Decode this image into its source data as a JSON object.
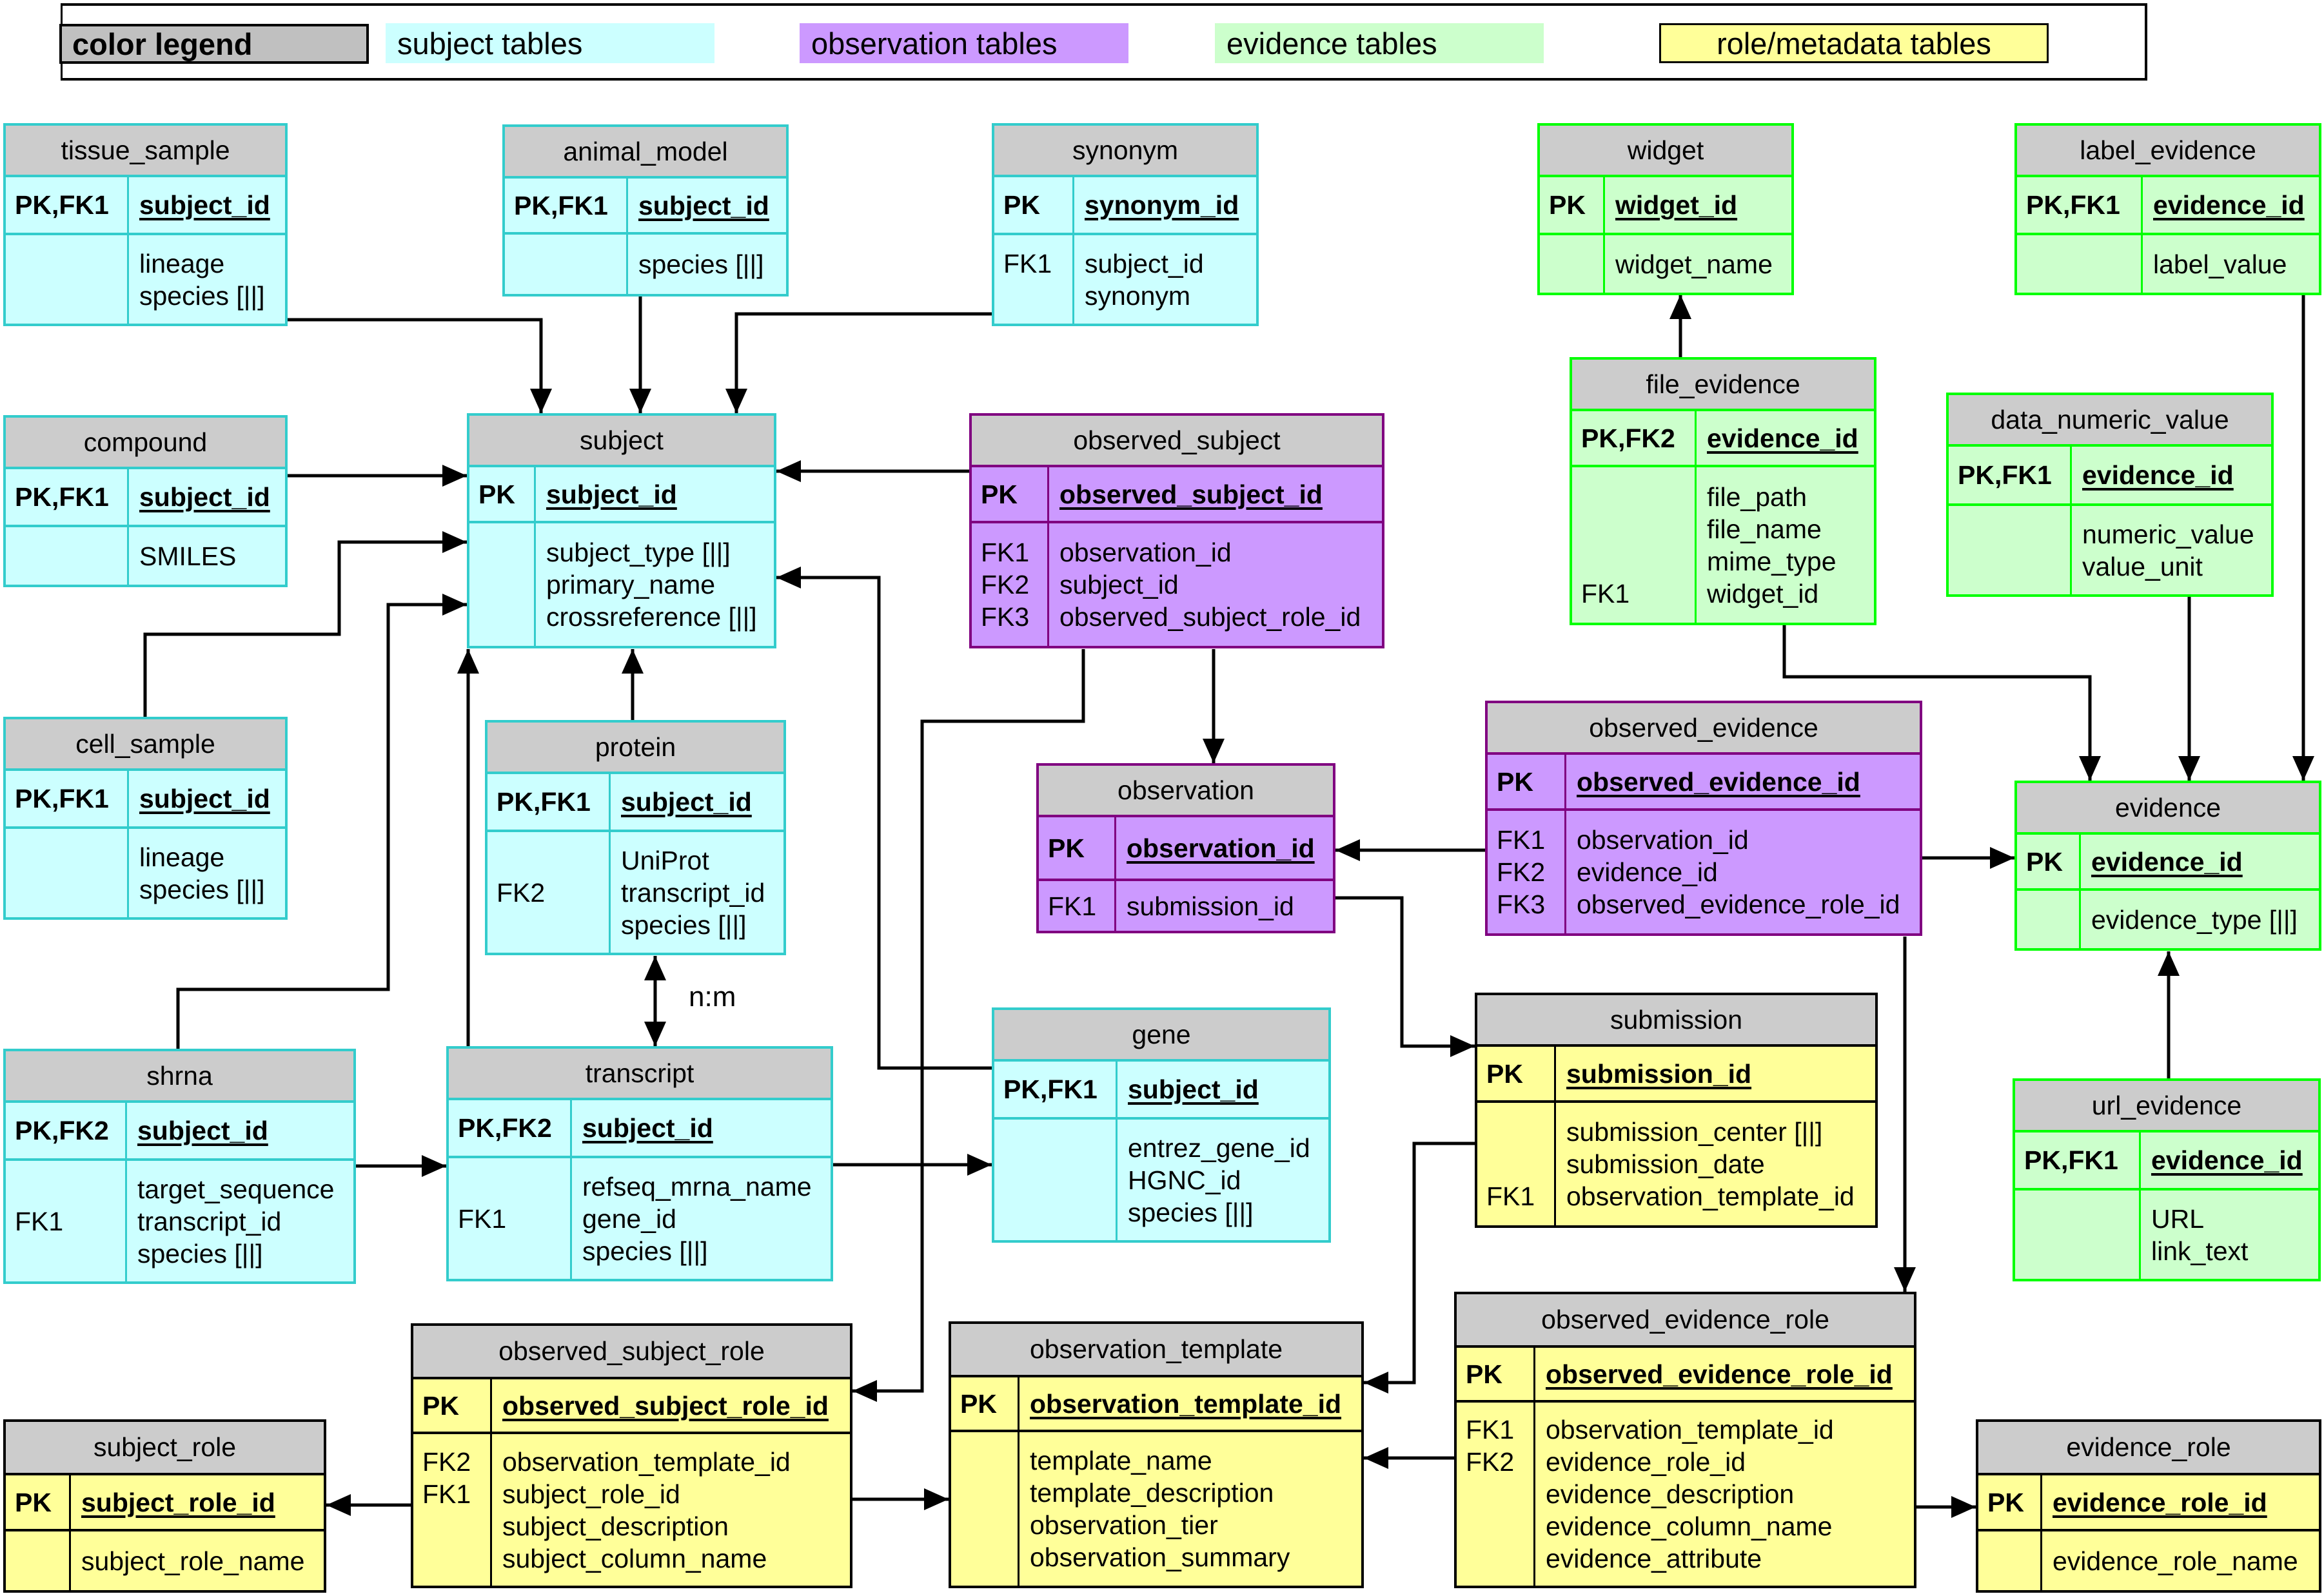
{
  "legend": {
    "title": "color legend",
    "items": [
      {
        "label": "subject tables",
        "color": "#ccffff"
      },
      {
        "label": "observation tables",
        "color": "#cc99ff"
      },
      {
        "label": "evidence tables",
        "color": "#ccffcc"
      },
      {
        "label": "role/metadata tables",
        "color": "#ffff99"
      }
    ]
  },
  "header_color": "#cccccc",
  "relationship_label": "n:m",
  "tables": {
    "tissue_sample": {
      "name": "tissue_sample",
      "category": "subject",
      "pk": {
        "key": "PK,FK1",
        "field": "subject_id"
      },
      "fields": [
        {
          "key": "",
          "field": "lineage"
        },
        {
          "key": "",
          "field": "species [||]"
        }
      ]
    },
    "animal_model": {
      "name": "animal_model",
      "category": "subject",
      "pk": {
        "key": "PK,FK1",
        "field": "subject_id"
      },
      "fields": [
        {
          "key": "",
          "field": "species [||]"
        }
      ]
    },
    "synonym": {
      "name": "synonym",
      "category": "subject",
      "pk": {
        "key": "PK",
        "field": "synonym_id"
      },
      "fields": [
        {
          "key": "FK1",
          "field": "subject_id"
        },
        {
          "key": "",
          "field": "synonym"
        }
      ]
    },
    "widget": {
      "name": "widget",
      "category": "evidence",
      "pk": {
        "key": "PK",
        "field": "widget_id"
      },
      "fields": [
        {
          "key": "",
          "field": "widget_name"
        }
      ]
    },
    "label_evidence": {
      "name": "label_evidence",
      "category": "evidence",
      "pk": {
        "key": "PK,FK1",
        "field": "evidence_id"
      },
      "fields": [
        {
          "key": "",
          "field": "label_value"
        }
      ]
    },
    "compound": {
      "name": "compound",
      "category": "subject",
      "pk": {
        "key": "PK,FK1",
        "field": "subject_id"
      },
      "fields": [
        {
          "key": "",
          "field": "SMILES"
        }
      ]
    },
    "subject": {
      "name": "subject",
      "category": "subject",
      "pk": {
        "key": "PK",
        "field": "subject_id"
      },
      "fields": [
        {
          "key": "",
          "field": "subject_type [||]"
        },
        {
          "key": "",
          "field": "primary_name"
        },
        {
          "key": "",
          "field": "crossreference [||]"
        }
      ]
    },
    "observed_subject": {
      "name": "observed_subject",
      "category": "observation",
      "pk": {
        "key": "PK",
        "field": "observed_subject_id"
      },
      "fields": [
        {
          "key": "FK1",
          "field": "observation_id"
        },
        {
          "key": "FK2",
          "field": "subject_id"
        },
        {
          "key": "FK3",
          "field": "observed_subject_role_id"
        }
      ]
    },
    "file_evidence": {
      "name": "file_evidence",
      "category": "evidence",
      "pk": {
        "key": "PK,FK2",
        "field": "evidence_id"
      },
      "fields": [
        {
          "key": "",
          "field": "file_path"
        },
        {
          "key": "",
          "field": "file_name"
        },
        {
          "key": "",
          "field": "mime_type"
        },
        {
          "key": "FK1",
          "field": "widget_id"
        }
      ]
    },
    "data_numeric_value": {
      "name": "data_numeric_value",
      "category": "evidence",
      "pk": {
        "key": "PK,FK1",
        "field": "evidence_id"
      },
      "fields": [
        {
          "key": "",
          "field": "numeric_value"
        },
        {
          "key": "",
          "field": "value_unit"
        }
      ]
    },
    "cell_sample": {
      "name": "cell_sample",
      "category": "subject",
      "pk": {
        "key": "PK,FK1",
        "field": "subject_id"
      },
      "fields": [
        {
          "key": "",
          "field": "lineage"
        },
        {
          "key": "",
          "field": "species [||]"
        }
      ]
    },
    "protein": {
      "name": "protein",
      "category": "subject",
      "pk": {
        "key": "PK,FK1",
        "field": "subject_id"
      },
      "fields": [
        {
          "key": "",
          "field": "UniProt"
        },
        {
          "key": "FK2",
          "field": "transcript_id"
        },
        {
          "key": "",
          "field": "species [||]"
        }
      ]
    },
    "observation": {
      "name": "observation",
      "category": "observation",
      "pk": {
        "key": "PK",
        "field": "observation_id"
      },
      "fields": [
        {
          "key": "FK1",
          "field": "submission_id"
        }
      ]
    },
    "observed_evidence": {
      "name": "observed_evidence",
      "category": "observation",
      "pk": {
        "key": "PK",
        "field": "observed_evidence_id"
      },
      "fields": [
        {
          "key": "FK1",
          "field": "observation_id"
        },
        {
          "key": "FK2",
          "field": "evidence_id"
        },
        {
          "key": "FK3",
          "field": "observed_evidence_role_id"
        }
      ]
    },
    "evidence": {
      "name": "evidence",
      "category": "evidence",
      "pk": {
        "key": "PK",
        "field": "evidence_id"
      },
      "fields": [
        {
          "key": "",
          "field": "evidence_type [||]"
        }
      ]
    },
    "shrna": {
      "name": "shrna",
      "category": "subject",
      "pk": {
        "key": "PK,FK2",
        "field": "subject_id"
      },
      "fields": [
        {
          "key": "",
          "field": "target_sequence"
        },
        {
          "key": "FK1",
          "field": "transcript_id"
        },
        {
          "key": "",
          "field": "species [||]"
        }
      ]
    },
    "transcript": {
      "name": "transcript",
      "category": "subject",
      "pk": {
        "key": "PK,FK2",
        "field": "subject_id"
      },
      "fields": [
        {
          "key": "",
          "field": "refseq_mrna_name"
        },
        {
          "key": "FK1",
          "field": "gene_id"
        },
        {
          "key": "",
          "field": "species [||]"
        }
      ]
    },
    "gene": {
      "name": "gene",
      "category": "subject",
      "pk": {
        "key": "PK,FK1",
        "field": "subject_id"
      },
      "fields": [
        {
          "key": "",
          "field": "entrez_gene_id"
        },
        {
          "key": "",
          "field": "HGNC_id"
        },
        {
          "key": "",
          "field": "species [||]"
        }
      ]
    },
    "submission": {
      "name": "submission",
      "category": "meta",
      "pk": {
        "key": "PK",
        "field": "submission_id"
      },
      "fields": [
        {
          "key": "",
          "field": "submission_center [||]"
        },
        {
          "key": "",
          "field": "submission_date"
        },
        {
          "key": "FK1",
          "field": "observation_template_id"
        }
      ]
    },
    "url_evidence": {
      "name": "url_evidence",
      "category": "evidence",
      "pk": {
        "key": "PK,FK1",
        "field": "evidence_id"
      },
      "fields": [
        {
          "key": "",
          "field": "URL"
        },
        {
          "key": "",
          "field": "link_text"
        }
      ]
    },
    "observed_subject_role": {
      "name": "observed_subject_role",
      "category": "meta",
      "pk": {
        "key": "PK",
        "field": "observed_subject_role_id"
      },
      "fields": [
        {
          "key": "FK2",
          "field": "observation_template_id"
        },
        {
          "key": "FK1",
          "field": "subject_role_id"
        },
        {
          "key": "",
          "field": "subject_description"
        },
        {
          "key": "",
          "field": "subject_column_name"
        }
      ]
    },
    "observation_template": {
      "name": "observation_template",
      "category": "meta",
      "pk": {
        "key": "PK",
        "field": "observation_template_id"
      },
      "fields": [
        {
          "key": "",
          "field": "template_name"
        },
        {
          "key": "",
          "field": "template_description"
        },
        {
          "key": "",
          "field": "observation_tier"
        },
        {
          "key": "",
          "field": "observation_summary"
        }
      ]
    },
    "observed_evidence_role": {
      "name": "observed_evidence_role",
      "category": "meta",
      "pk": {
        "key": "PK",
        "field": "observed_evidence_role_id"
      },
      "fields": [
        {
          "key": "FK1",
          "field": "observation_template_id"
        },
        {
          "key": "FK2",
          "field": "evidence_role_id"
        },
        {
          "key": "",
          "field": "evidence_description"
        },
        {
          "key": "",
          "field": "evidence_column_name"
        },
        {
          "key": "",
          "field": "evidence_attribute"
        }
      ]
    },
    "subject_role": {
      "name": "subject_role",
      "category": "meta",
      "pk": {
        "key": "PK",
        "field": "subject_role_id"
      },
      "fields": [
        {
          "key": "",
          "field": "subject_role_name"
        }
      ]
    },
    "evidence_role": {
      "name": "evidence_role",
      "category": "meta",
      "pk": {
        "key": "PK",
        "field": "evidence_role_id"
      },
      "fields": [
        {
          "key": "",
          "field": "evidence_role_name"
        }
      ]
    }
  },
  "relationships": [
    {
      "from": "tissue_sample",
      "to": "subject"
    },
    {
      "from": "animal_model",
      "to": "subject"
    },
    {
      "from": "synonym",
      "to": "subject"
    },
    {
      "from": "compound",
      "to": "subject"
    },
    {
      "from": "cell_sample",
      "to": "subject"
    },
    {
      "from": "shrna",
      "to": "subject"
    },
    {
      "from": "transcript",
      "to": "subject"
    },
    {
      "from": "protein",
      "to": "subject"
    },
    {
      "from": "gene",
      "to": "subject"
    },
    {
      "from": "observed_subject",
      "to": "subject"
    },
    {
      "from": "observed_subject",
      "to": "observation"
    },
    {
      "from": "observed_subject",
      "to": "observed_subject_role"
    },
    {
      "from": "protein",
      "to": "transcript",
      "label": "n:m"
    },
    {
      "from": "shrna",
      "to": "transcript"
    },
    {
      "from": "transcript",
      "to": "gene"
    },
    {
      "from": "file_evidence",
      "to": "widget"
    },
    {
      "from": "file_evidence",
      "to": "evidence"
    },
    {
      "from": "data_numeric_value",
      "to": "evidence"
    },
    {
      "from": "label_evidence",
      "to": "evidence"
    },
    {
      "from": "url_evidence",
      "to": "evidence"
    },
    {
      "from": "observed_evidence",
      "to": "evidence"
    },
    {
      "from": "observed_evidence",
      "to": "observation"
    },
    {
      "from": "observed_evidence",
      "to": "observed_evidence_role"
    },
    {
      "from": "observation",
      "to": "submission"
    },
    {
      "from": "submission",
      "to": "observation_template"
    },
    {
      "from": "observed_subject_role",
      "to": "observation_template"
    },
    {
      "from": "observed_subject_role",
      "to": "subject_role"
    },
    {
      "from": "observed_evidence_role",
      "to": "observation_template"
    },
    {
      "from": "observed_evidence_role",
      "to": "evidence_role"
    }
  ]
}
